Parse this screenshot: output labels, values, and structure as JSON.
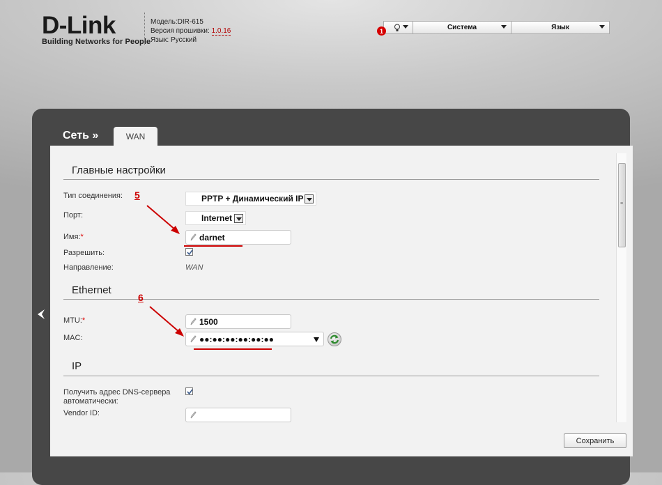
{
  "header": {
    "logo_text": "D-Link",
    "logo_tagline": "Building Networks for People",
    "model_label": "Модель:",
    "model_value": "DIR-615",
    "firmware_label": "Версия прошивки:",
    "firmware_value": "1.0.16",
    "language_label": "Язык:",
    "language_value": "Русский"
  },
  "topbar": {
    "notification_count": "1",
    "menu_system": "Система",
    "menu_language": "Язык"
  },
  "nav": {
    "breadcrumb": "Сеть »",
    "active_tab": "WAN"
  },
  "sections": {
    "main_title": "Главные настройки",
    "ethernet_title": "Ethernet",
    "ip_title": "IP"
  },
  "form": {
    "connection_type_label": "Тип соединения:",
    "connection_type_value": "PPTP + Динамический IP",
    "port_label": "Порт:",
    "port_value": "Internet",
    "name_label": "Имя:",
    "name_value": "darnet",
    "enable_label": "Разрешить:",
    "enable_checked": true,
    "direction_label": "Направление:",
    "direction_value": "WAN",
    "mtu_label": "MTU:",
    "mtu_value": "1500",
    "mac_label": "MAC:",
    "mac_value": "●●:●●:●●:●●:●●:●●",
    "dns_auto_label_1": "Получить адрес DNS-сервера",
    "dns_auto_label_2": "автоматически:",
    "dns_auto_checked": true,
    "vendor_id_label": "Vendor ID:",
    "vendor_id_value": "",
    "required_mark": "*"
  },
  "annotations": {
    "marker_5": "5",
    "marker_6": "6"
  },
  "actions": {
    "save_label": "Сохранить"
  },
  "colors": {
    "panel_bg": "#474747",
    "content_bg": "#f2f2f2",
    "annotation_red": "#cc0000",
    "notification_red": "#d60000"
  }
}
